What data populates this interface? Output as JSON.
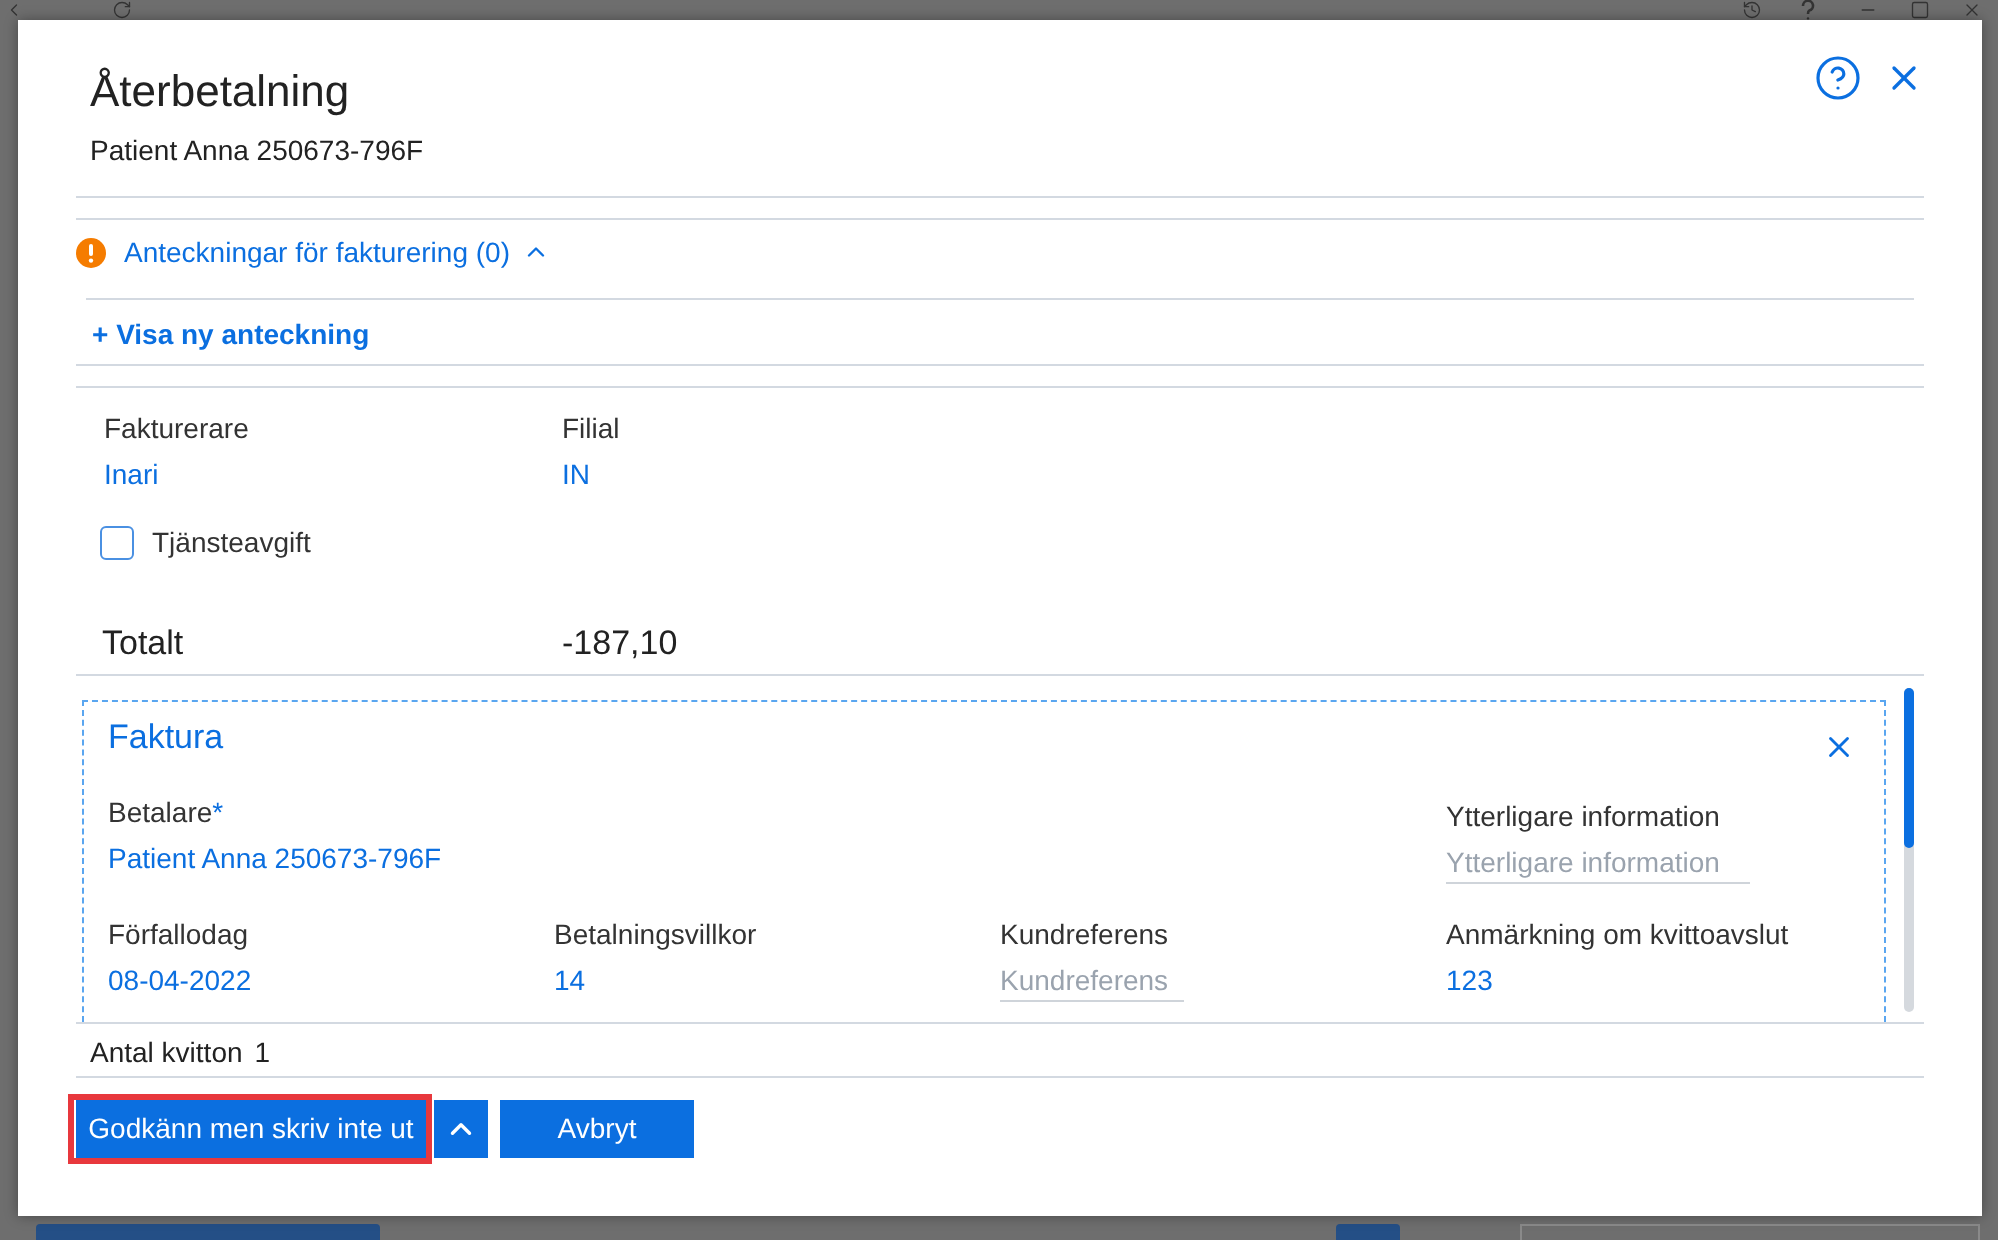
{
  "dialog": {
    "title": "Återbetalning",
    "subtitle": "Patient Anna 250673-796F"
  },
  "notes": {
    "label": "Anteckningar för fakturering (0)",
    "expanded": true,
    "add_link": "+ Visa ny anteckning"
  },
  "fields": [
    {
      "label": "Fakturerare",
      "value": "Inari"
    },
    {
      "label": "Filial",
      "value": "IN"
    }
  ],
  "service_fee": {
    "label": "Tjänsteavgift",
    "checked": false
  },
  "total": {
    "label": "Totalt",
    "value": "-187,10"
  },
  "invoice": {
    "title": "Faktura",
    "payer": {
      "label": "Betalare",
      "required_mark": "*",
      "value": "Patient Anna 250673-796F"
    },
    "additional_info": {
      "label": "Ytterligare information",
      "placeholder": "Ytterligare information"
    },
    "details": [
      {
        "kind": "value",
        "label": "Förfallodag",
        "value": "08-04-2022"
      },
      {
        "kind": "value",
        "label": "Betalningsvillkor",
        "value": "14"
      },
      {
        "kind": "input",
        "label": "Kundreferens",
        "placeholder": "Kundreferens"
      },
      {
        "kind": "value",
        "label": "Anmärkning om kvittoavslut",
        "value": "123"
      }
    ]
  },
  "receipt_count": {
    "label": "Antal kvitton",
    "value": "1"
  },
  "actions": {
    "primary": {
      "label": "Godkänn men skriv inte ut",
      "highlighted": true
    },
    "cancel": "Avbryt"
  }
}
